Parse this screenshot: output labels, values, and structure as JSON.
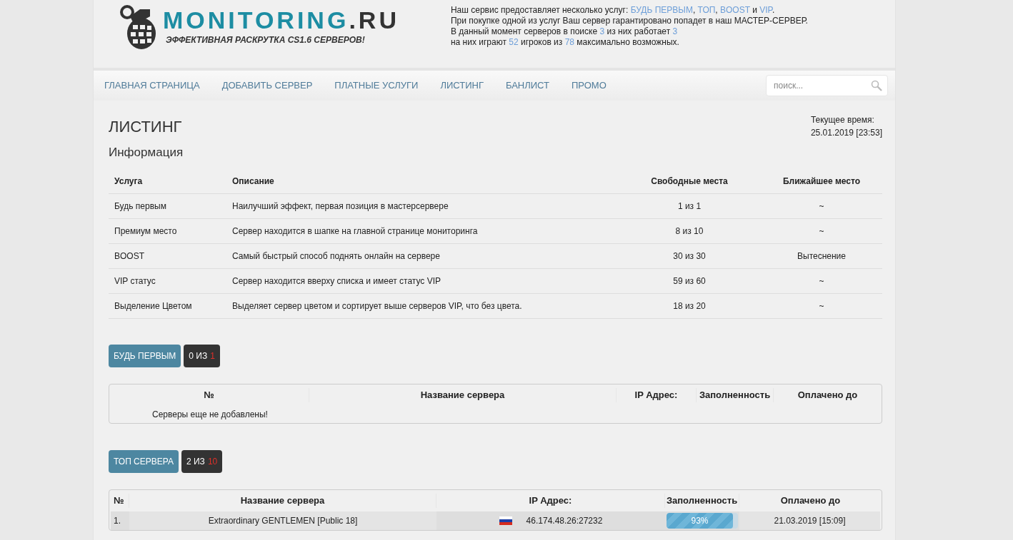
{
  "logo": {
    "name": "MONITORING",
    "domain": ".RU",
    "tagline": "ЭФФЕКТИВНАЯ РАСКРУТКА CS1.6 СЕРВЕРОВ!"
  },
  "header_info": [
    [
      {
        "kind": "text",
        "text": "Наш сервис предоставляет несколько услуг: "
      },
      {
        "kind": "link",
        "text": "БУДЬ ПЕРВЫМ"
      },
      {
        "kind": "text",
        "text": ", "
      },
      {
        "kind": "link",
        "text": "ТОП"
      },
      {
        "kind": "text",
        "text": ", "
      },
      {
        "kind": "link",
        "text": "BOOST"
      },
      {
        "kind": "text",
        "text": " и "
      },
      {
        "kind": "link",
        "text": "VIP"
      },
      {
        "kind": "text",
        "text": "."
      }
    ],
    [
      {
        "kind": "text",
        "text": "При покупке одной из услуг Ваш сервер гарантировано попадет в наш МАСТЕР-СЕРВЕР."
      }
    ],
    [
      {
        "kind": "text",
        "text": "В данный момент серверов в поиске "
      },
      {
        "kind": "number",
        "text": "3"
      },
      {
        "kind": "text",
        "text": " из них работает "
      },
      {
        "kind": "number",
        "text": "3"
      }
    ],
    [
      {
        "kind": "text",
        "text": "на них играют "
      },
      {
        "kind": "number",
        "text": "52"
      },
      {
        "kind": "text",
        "text": " игроков из "
      },
      {
        "kind": "number",
        "text": "78"
      },
      {
        "kind": "text",
        "text": " максимально возможных."
      }
    ]
  ],
  "nav": {
    "items": [
      "ГЛАВНАЯ СТРАНИЦА",
      "ДОБАВИТЬ СЕРВЕР",
      "ПЛАТНЫЕ УСЛУГИ",
      "ЛИСТИНГ",
      "БАНЛИСТ",
      "ПРОМО"
    ],
    "search_placeholder": "поиск..."
  },
  "page_title": "ЛИСТИНГ",
  "current_time": {
    "label": "Текущее время:",
    "value": "25.01.2019 [23:53]"
  },
  "info": {
    "title": "Информация",
    "columns": [
      "Услуга",
      "Описание",
      "Свободные места",
      "Ближайшее место"
    ],
    "rows": [
      [
        "Будь первым",
        "Наилучший эффект, первая позиция в мастерсервере",
        "1 из 1",
        "~"
      ],
      [
        "Премиум место",
        "Сервер находится в шапке на главной странице мониторинга",
        "8 из 10",
        "~"
      ],
      [
        "BOOST",
        "Самый быстрый способ поднять онлайн на сервере",
        "30 из 30",
        "Вытеснение"
      ],
      [
        "VIP статус",
        "Сервер находится вверху списка и имеет статус VIP",
        "59 из 60",
        "~"
      ],
      [
        "Выделение Цветом",
        "Выделяет сервер цветом и сортирует выше серверов VIP, что без цвета.",
        "18 из 20",
        "~"
      ]
    ]
  },
  "sections": [
    {
      "button": "БУДЬ ПЕРВЫМ",
      "count": "0 ИЗ",
      "total": "1",
      "columns": [
        "№",
        "Название сервера",
        "IP Адрес:",
        "Заполненность",
        "Оплачено до"
      ],
      "empty_message": "Серверы еще не добавлены!"
    },
    {
      "button": "ТОП СЕРВЕРА",
      "count": "2 ИЗ",
      "total": "10",
      "columns": [
        "№",
        "Название сервера",
        "IP Адрес:",
        "Заполненность",
        "Оплачено до"
      ],
      "rows": [
        {
          "number": "1.",
          "name": "Extraordinary GENTLEMEN [Public 18]",
          "ip": "46.174.48.26:27232",
          "level": 0.93,
          "fill": "93%",
          "paid_until": "21.03.2019 [15:09]"
        }
      ]
    }
  ]
}
